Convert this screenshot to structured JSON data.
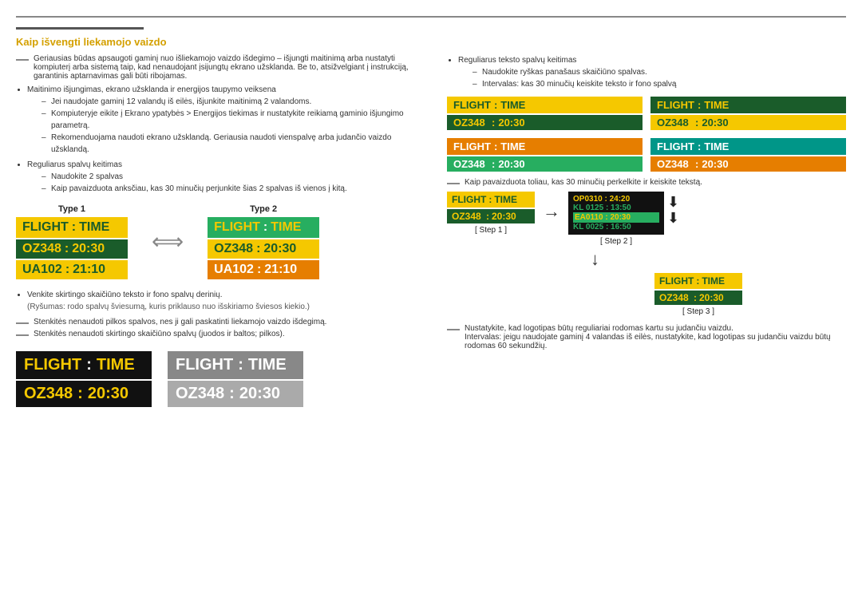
{
  "page": {
    "top_rule": true
  },
  "section_title": "Kaip išvengti liekamojo vaizdo",
  "left_col": {
    "intro_text": "Geriausias būdas apsaugoti gaminį nuo išliekamojo vaizdo išdegimo – išjungti maitinimą arba nustatyti kompiuterį arba sistemą taip, kad nenaudojant įsijungtų ekrano užsklanda. Be to, atsižvelgiant į instrukciją, garantinis aptarnavimas gali būti ribojamas.",
    "bullets": [
      {
        "text": "Maitinimo išjungimas, ekrano užsklanda ir energijos taupymo veiksena",
        "sub": [
          "Jei naudojate gaminį 12 valandų iš eilės, išjunkite maitinimą 2 valandoms.",
          "Kompiuteryje eikite į Ekrano ypatybės > Energijos tiekimas ir nustatykite reikiamą gaminio išjungimo parametrą.",
          "Rekomenduojama naudoti ekrano užsklandą. Geriausia naudoti vienspalvę arba judančio vaizdo užsklandą."
        ]
      },
      {
        "text": "Reguliarus spalvų keitimas",
        "sub": [
          "Naudokite 2 spalvas",
          "Kaip pavaizduota anksčiau, kas 30 minučių perjunkite šias 2 spalvas iš vienos į kitą."
        ]
      }
    ],
    "type1_label": "Type 1",
    "type2_label": "Type 2",
    "type1_board": {
      "header": [
        "FLIGHT",
        ":",
        "TIME"
      ],
      "rows": [
        [
          "OZ348",
          ":",
          "20:30"
        ],
        [
          "UA102",
          ":",
          "21:10"
        ]
      ]
    },
    "type2_board": {
      "header": [
        "FLIGHT",
        ":",
        "TIME"
      ],
      "rows": [
        [
          "OZ348",
          ":",
          "20:30"
        ],
        [
          "UA102",
          ":",
          "21:10"
        ]
      ]
    },
    "note1": "Venkite skirtingo skaičiūno teksto ir fono spalvų derinių.",
    "note1_sub": "(Ryšumas: rodo spalvų šviesumą, kuris priklauso nuo išskiriamo šviesos kiekio.)",
    "note2": "Stenkitės nenaudoti pilkos spalvos, nes ji gali paskatinti liekamojo vaizdo išdegimą.",
    "note3": "Stenkitės nenaudoti skirtingo skaičiūno spalvų (juodos ir baltos; pilkos).",
    "bottom_board1": {
      "header": [
        "FLIGHT",
        ":",
        "TIME"
      ],
      "data": [
        "OZ348",
        ":",
        "20:30"
      ]
    },
    "bottom_board2": {
      "header": [
        "FLIGHT",
        ":",
        "TIME"
      ],
      "data": [
        "OZ348",
        ":",
        "20:30"
      ]
    }
  },
  "right_col": {
    "bullet": "Reguliarus teksto spalvų keitimas",
    "sub1": "Naudokite ryškas panašaus skaičiūno spalvas.",
    "sub2": "Intervalas: kas 30 minučių keiskite teksto ir fono spalvą",
    "boards_row1": [
      {
        "header_bg": "#f5c800",
        "header_text_color": "#1a5c2a",
        "data_bg": "#1a5c2a",
        "data_text_color": "#f5c800",
        "header": [
          "FLIGHT",
          ":",
          "TIME"
        ],
        "data": [
          "OZ348",
          ":",
          "20:30"
        ]
      },
      {
        "header_bg": "#1a5c2a",
        "header_text_color": "#f5c800",
        "data_bg": "#f5c800",
        "data_text_color": "#1a5c2a",
        "header": [
          "FLIGHT",
          ":",
          "TIME"
        ],
        "data": [
          "OZ348",
          ":",
          "20:30"
        ]
      }
    ],
    "boards_row2": [
      {
        "header_bg": "#e67e00",
        "header_text_color": "#fff",
        "data_bg": "#27ae60",
        "data_text_color": "#fff",
        "header": [
          "FLIGHT",
          ":",
          "TIME"
        ],
        "data": [
          "OZ348",
          ":",
          "20:30"
        ]
      },
      {
        "header_bg": "#009688",
        "header_text_color": "#fff",
        "data_bg": "#e67e00",
        "data_text_color": "#fff",
        "header": [
          "FLIGHT",
          ":",
          "TIME"
        ],
        "data": [
          "OZ348",
          ":",
          "20:30"
        ]
      }
    ],
    "note_scroll": "Kaip pavaizduota toliau, kas 30 minučių perkelkite ir keiskite tekstą.",
    "step1_label": "[ Step 1 ]",
    "step2_label": "[ Step 2 ]",
    "step3_label": "[ Step 3 ]",
    "step1_board": {
      "header_bg": "#f5c800",
      "header_text_color": "#1a5c2a",
      "data_bg": "#1a5c2a",
      "data_text_color": "#f5c800",
      "header": [
        "FLIGHT",
        ":",
        "TIME"
      ],
      "data": [
        "OZ348",
        ":",
        "20:30"
      ]
    },
    "step2_rows": [
      "OP0310 : 24:20",
      "KL 0125 : 13:50",
      "EA0110 : 20:30",
      "KL 0025 : 16:50"
    ],
    "step3_board": {
      "header_bg": "#f5c800",
      "header_text_color": "#1a5c2a",
      "data_bg": "#1a5c2a",
      "data_text_color": "#f5c800",
      "header": [
        "FLIGHT",
        ":",
        "TIME"
      ],
      "data": [
        "OZ348",
        ":",
        "20:30"
      ]
    },
    "note_logo": "Nustatykite, kad logotipas būtų reguliariai rodomas kartu su judančiu vaizdu.",
    "note_logo2": "Intervalas: jeigu naudojate gaminį 4 valandas iš eilės, nustatykite, kad logotipas su judančiu vaizdu būtų rodomas 60 sekundžių."
  }
}
